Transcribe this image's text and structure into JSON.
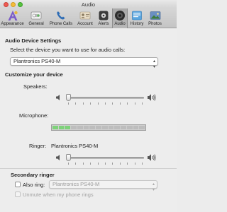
{
  "window": {
    "title": "Audio"
  },
  "toolbar": {
    "items": [
      {
        "label": "Appearance",
        "icon": "appearance-icon"
      },
      {
        "label": "General",
        "icon": "general-switch-icon"
      },
      {
        "label": "Phone Calls",
        "icon": "phone-calls-icon"
      },
      {
        "label": "Account",
        "icon": "account-icon"
      },
      {
        "label": "Alerts",
        "icon": "alerts-icon"
      },
      {
        "label": "Audio",
        "icon": "audio-speaker-icon",
        "selected": true
      },
      {
        "label": "History",
        "icon": "history-icon"
      },
      {
        "label": "Photos",
        "icon": "photos-icon"
      }
    ]
  },
  "audio_device": {
    "header": "Audio Device Settings",
    "prompt": "Select the device you want to use for audio calls:",
    "selected_device": "Plantronics PS40-M"
  },
  "customize": {
    "header": "Customize your device",
    "speakers_label": "Speakers:",
    "speakers_level": 0.0,
    "microphone_label": "Microphone:",
    "microphone_segments_total": 15,
    "microphone_segments_lit": 3,
    "ringer_label": "Ringer:",
    "ringer_device": "Plantronics PS40-M",
    "ringer_level": 0.0
  },
  "secondary_ringer": {
    "header": "Secondary ringer",
    "also_ring_label": "Also ring:",
    "also_ring_checked": false,
    "also_ring_device": "Plantronics PS40-M",
    "unmute_label": "Unmute when my phone rings",
    "unmute_checked": false
  },
  "colors": {
    "meter_on": "#7ed27a",
    "meter_off": "#bdbdbd",
    "close": "#ee5a52",
    "minimize": "#f5bd3a",
    "maximize": "#59c33f"
  }
}
